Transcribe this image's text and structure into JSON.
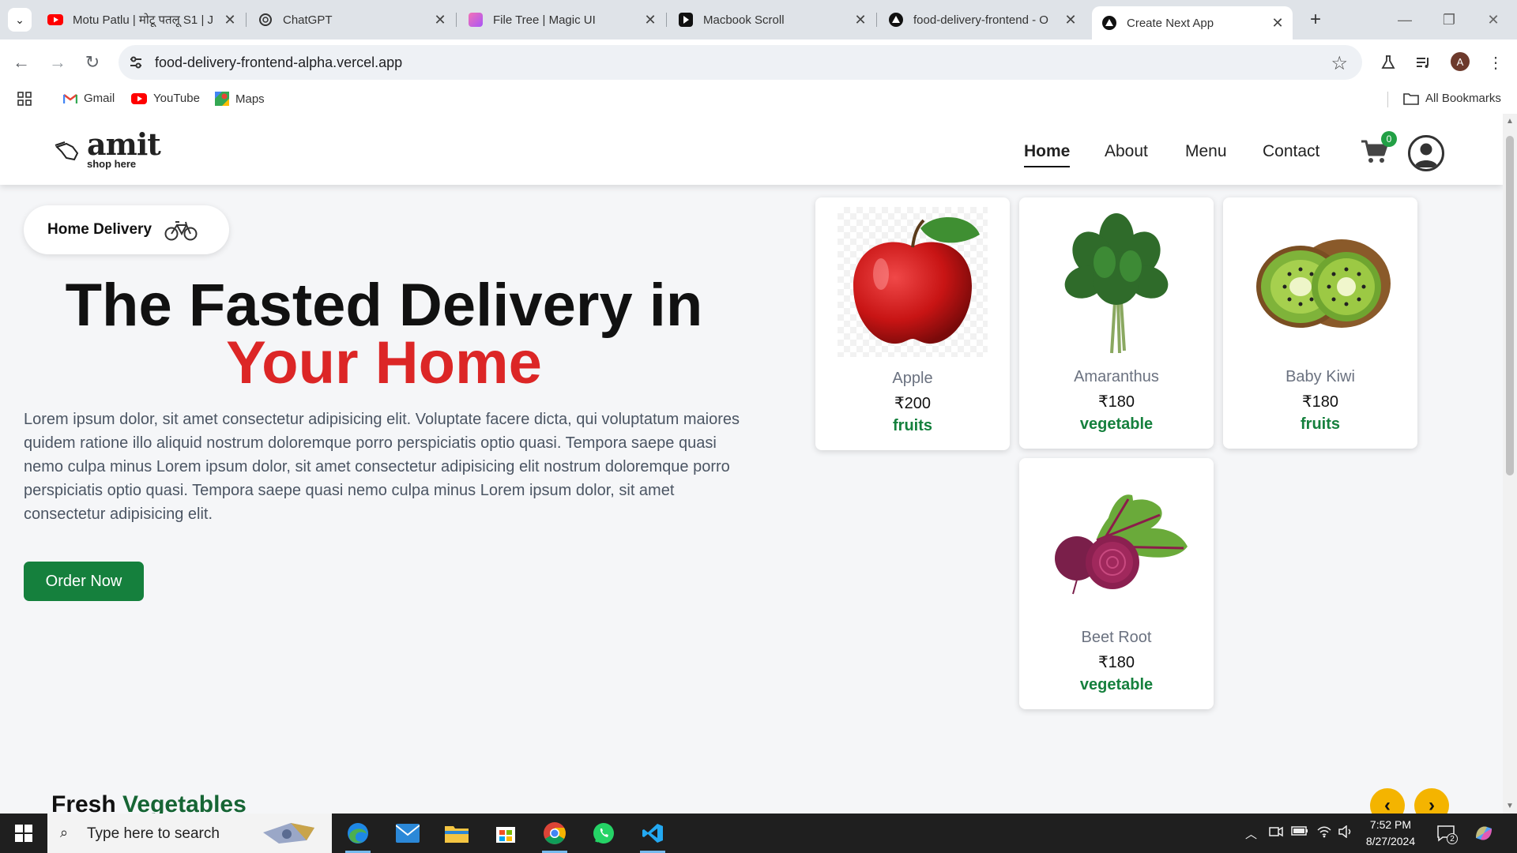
{
  "browser": {
    "tabs": [
      {
        "title": "Motu Patlu | मोटू पतलू S1 | J",
        "favicon": "youtube-icon"
      },
      {
        "title": "ChatGPT",
        "favicon": "chatgpt-icon"
      },
      {
        "title": "File Tree | Magic UI",
        "favicon": "magicui-icon"
      },
      {
        "title": "Macbook Scroll",
        "favicon": "play-icon"
      },
      {
        "title": "food-delivery-frontend - O",
        "favicon": "vercel-icon"
      },
      {
        "title": "Create Next App",
        "favicon": "vercel-icon",
        "active": true
      }
    ],
    "url": "food-delivery-frontend-alpha.vercel.app",
    "profile_initial": "A",
    "bookmarks": [
      {
        "label": "Gmail",
        "icon": "gmail-icon"
      },
      {
        "label": "YouTube",
        "icon": "youtube-icon"
      },
      {
        "label": "Maps",
        "icon": "maps-icon"
      }
    ],
    "all_bookmarks": "All Bookmarks"
  },
  "site": {
    "logo": {
      "word": "amit",
      "tagline": "shop here"
    },
    "nav": [
      "Home",
      "About",
      "Menu",
      "Contact"
    ],
    "active_nav": "Home",
    "cart_count": "0",
    "hero": {
      "badge": "Home Delivery",
      "title_line1": "The Fasted Delivery in",
      "title_line2": "Your Home",
      "description": "Lorem ipsum dolor, sit amet consectetur adipisicing elit. Voluptate facere dicta, qui voluptatum maiores quidem ratione illo aliquid nostrum doloremque porro perspiciatis optio quasi. Tempora saepe quasi nemo culpa minus Lorem ipsum dolor, sit amet consectetur adipisicing elit nostrum doloremque porro perspiciatis optio quasi. Tempora saepe quasi nemo culpa minus Lorem ipsum dolor, sit amet consectetur adipisicing elit.",
      "cta": "Order Now"
    },
    "products": [
      {
        "name": "Apple",
        "price": "₹200",
        "category": "fruits"
      },
      {
        "name": "Amaranthus",
        "price": "₹180",
        "category": "vegetable"
      },
      {
        "name": "Baby Kiwi",
        "price": "₹180",
        "category": "fruits"
      },
      {
        "name": "Beet Root",
        "price": "₹180",
        "category": "vegetable"
      }
    ],
    "section": {
      "title_part1": "Fresh",
      "title_part2": "Vegetables"
    }
  },
  "taskbar": {
    "search_placeholder": "Type here to search",
    "time": "7:52 PM",
    "date": "8/27/2024",
    "notification_count": "2"
  },
  "colors": {
    "accent_green": "#15803d",
    "accent_red": "#dc2626",
    "slider_yellow": "#f4b400"
  }
}
